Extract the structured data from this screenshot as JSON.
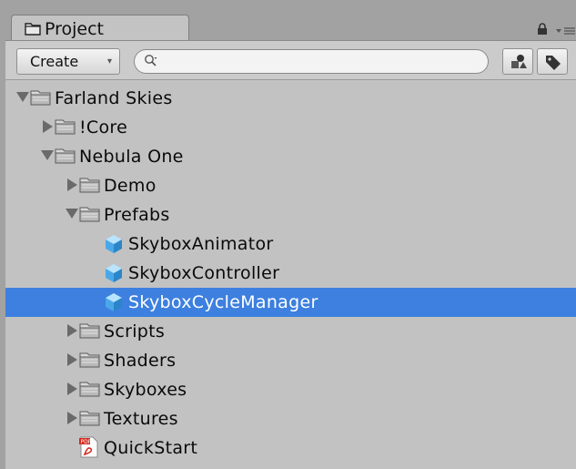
{
  "panel": {
    "tab_label": "Project",
    "tab_icon": "folder-icon"
  },
  "toolbar": {
    "create_label": "Create",
    "create_arrow": "▾",
    "search_placeholder": "",
    "search_value": ""
  },
  "tree": [
    {
      "label": "Farland Skies",
      "depth": 0,
      "state": "open",
      "icon": "folder-icon",
      "selected": false
    },
    {
      "label": "!Core",
      "depth": 1,
      "state": "closed",
      "icon": "folder-icon",
      "selected": false
    },
    {
      "label": "Nebula One",
      "depth": 1,
      "state": "open",
      "icon": "folder-icon",
      "selected": false
    },
    {
      "label": "Demo",
      "depth": 2,
      "state": "closed",
      "icon": "folder-icon",
      "selected": false
    },
    {
      "label": "Prefabs",
      "depth": 2,
      "state": "open",
      "icon": "folder-icon",
      "selected": false
    },
    {
      "label": "SkyboxAnimator",
      "depth": 3,
      "state": "none",
      "icon": "prefab-icon",
      "selected": false
    },
    {
      "label": "SkyboxController",
      "depth": 3,
      "state": "none",
      "icon": "prefab-icon",
      "selected": false
    },
    {
      "label": "SkyboxCycleManager",
      "depth": 3,
      "state": "none",
      "icon": "prefab-icon",
      "selected": true
    },
    {
      "label": "Scripts",
      "depth": 2,
      "state": "closed",
      "icon": "folder-icon",
      "selected": false
    },
    {
      "label": "Shaders",
      "depth": 2,
      "state": "closed",
      "icon": "folder-icon",
      "selected": false
    },
    {
      "label": "Skyboxes",
      "depth": 2,
      "state": "closed",
      "icon": "folder-icon",
      "selected": false
    },
    {
      "label": "Textures",
      "depth": 2,
      "state": "closed",
      "icon": "folder-icon",
      "selected": false
    },
    {
      "label": "QuickStart",
      "depth": 2,
      "state": "none",
      "icon": "pdf-icon",
      "selected": false
    }
  ],
  "colors": {
    "selection": "#3d80df",
    "panel_bg": "#c2c2c2"
  }
}
